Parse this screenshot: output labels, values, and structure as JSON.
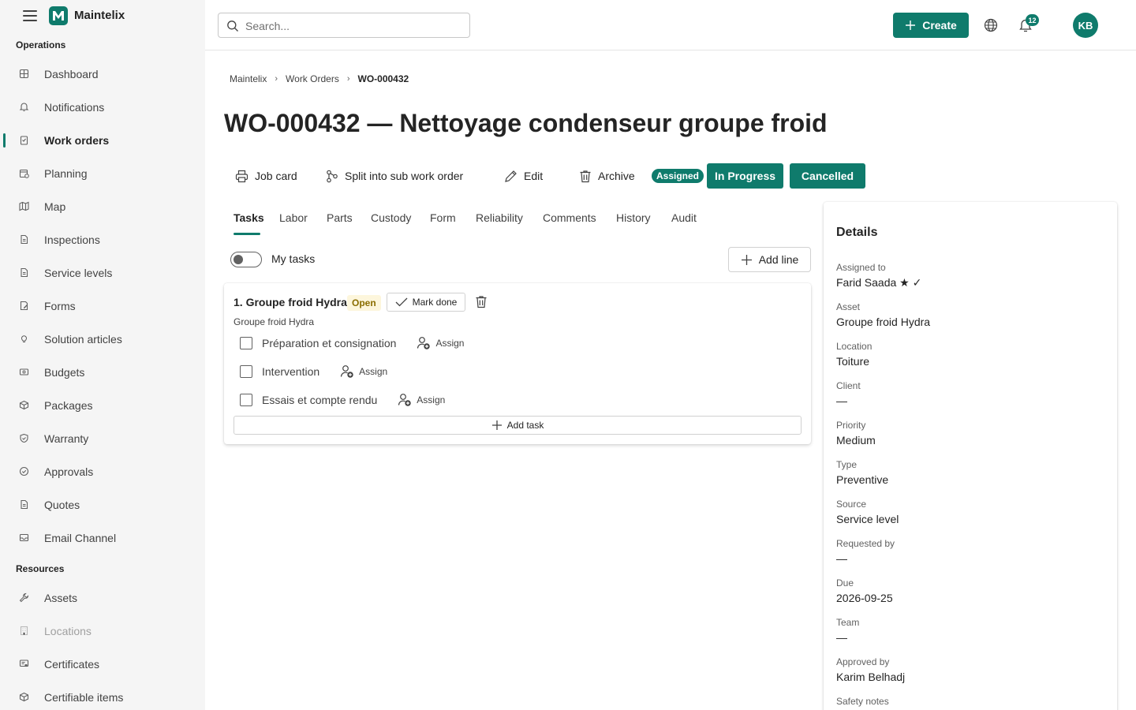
{
  "app": {
    "name": "Maintelix"
  },
  "sidebar": {
    "sections": [
      {
        "label": "Operations"
      },
      {
        "label": "Resources"
      }
    ],
    "items": [
      {
        "label": "Dashboard",
        "icon": "dashboard-icon"
      },
      {
        "label": "Notifications",
        "icon": "bell-icon"
      },
      {
        "label": "Work orders",
        "icon": "clipboard-icon",
        "active": true
      },
      {
        "label": "Planning",
        "icon": "calendar-icon"
      },
      {
        "label": "Map",
        "icon": "map-icon"
      },
      {
        "label": "Inspections",
        "icon": "document-icon"
      },
      {
        "label": "Service levels",
        "icon": "document-icon"
      },
      {
        "label": "Forms",
        "icon": "form-icon"
      },
      {
        "label": "Solution articles",
        "icon": "lightbulb-icon"
      },
      {
        "label": "Budgets",
        "icon": "money-icon"
      },
      {
        "label": "Packages",
        "icon": "package-icon"
      },
      {
        "label": "Warranty",
        "icon": "shield-icon"
      },
      {
        "label": "Approvals",
        "icon": "check-circle-icon"
      },
      {
        "label": "Quotes",
        "icon": "document-icon"
      },
      {
        "label": "Email Channel",
        "icon": "mail-icon"
      },
      {
        "label": "Assets",
        "icon": "wrench-icon"
      },
      {
        "label": "Locations",
        "icon": "building-icon",
        "disabled": true
      },
      {
        "label": "Certificates",
        "icon": "certificate-icon"
      },
      {
        "label": "Certifiable items",
        "icon": "package-icon"
      }
    ]
  },
  "topbar": {
    "search_placeholder": "Search...",
    "create_label": "Create",
    "notification_count": "12",
    "avatar_initials": "KB"
  },
  "breadcrumb": [
    "Maintelix",
    "Work Orders",
    "WO-000432"
  ],
  "page": {
    "title": "WO-000432 — Nettoyage condenseur groupe froid"
  },
  "toolbar": {
    "job_card": "Job card",
    "split": "Split into sub work order",
    "edit": "Edit",
    "archive": "Archive",
    "status_current": "Assigned",
    "status_in_progress": "In Progress",
    "status_cancelled": "Cancelled"
  },
  "tabs": [
    "Tasks",
    "Labor",
    "Parts",
    "Custody",
    "Form",
    "Reliability",
    "Comments",
    "History",
    "Audit"
  ],
  "tasks_view": {
    "my_tasks_label": "My tasks",
    "add_line_label": "Add line"
  },
  "task_card": {
    "title": "1. Groupe froid Hydra",
    "status": "Open",
    "mark_done": "Mark done",
    "subtitle": "Groupe froid Hydra",
    "subtasks": [
      {
        "label": "Préparation et consignation",
        "assign": "Assign"
      },
      {
        "label": "Intervention",
        "assign": "Assign"
      },
      {
        "label": "Essais et compte rendu",
        "assign": "Assign"
      }
    ],
    "add_task": "Add task"
  },
  "details": {
    "title": "Details",
    "fields": [
      {
        "label": "Assigned to",
        "value": "Farid Saada ★ ✓"
      },
      {
        "label": "Asset",
        "value": "Groupe froid Hydra"
      },
      {
        "label": "Location",
        "value": "Toiture"
      },
      {
        "label": "Client",
        "value": "—"
      },
      {
        "label": "Priority",
        "value": "Medium"
      },
      {
        "label": "Type",
        "value": "Preventive"
      },
      {
        "label": "Source",
        "value": "Service level"
      },
      {
        "label": "Requested by",
        "value": "—"
      },
      {
        "label": "Due",
        "value": "2026-09-25"
      },
      {
        "label": "Team",
        "value": "—"
      },
      {
        "label": "Approved by",
        "value": "Karim Belhadj"
      },
      {
        "label": "Safety notes",
        "value": ""
      }
    ]
  },
  "colors": {
    "accent": "#0f7b6c",
    "sidebar_bg": "#f5f5f5"
  }
}
